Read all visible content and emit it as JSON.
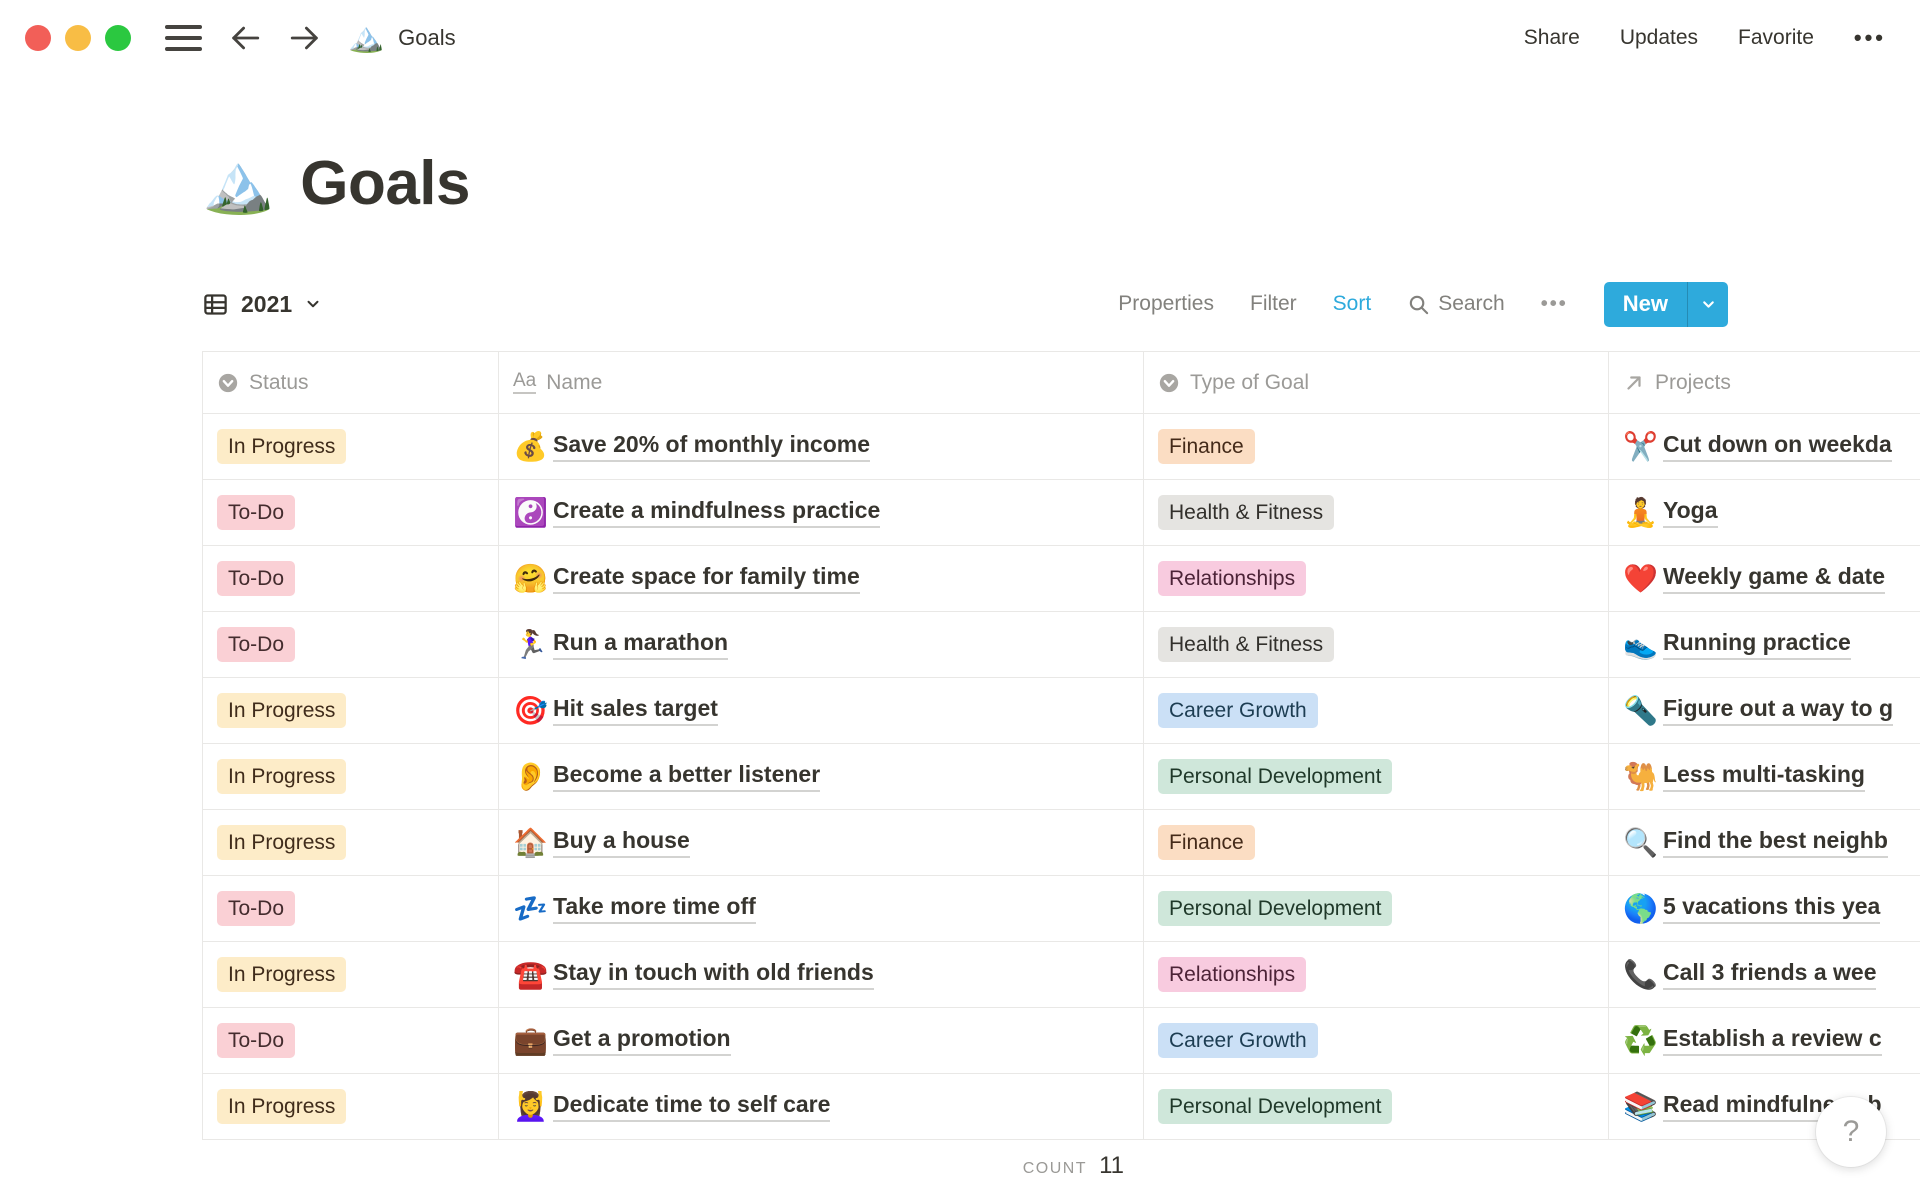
{
  "window": {
    "doc_emoji": "🏔️",
    "doc_title": "Goals",
    "actions": {
      "share": "Share",
      "updates": "Updates",
      "favorite": "Favorite"
    }
  },
  "page": {
    "emoji": "🏔️",
    "title": "Goals"
  },
  "viewbar": {
    "view_name": "2021",
    "properties": "Properties",
    "filter": "Filter",
    "sort": "Sort",
    "search": "Search",
    "new_label": "New"
  },
  "table": {
    "columns": [
      {
        "label": "Status"
      },
      {
        "label": "Name"
      },
      {
        "label": "Type of Goal"
      },
      {
        "label": "Projects"
      }
    ],
    "rows": [
      {
        "status": {
          "label": "In Progress",
          "variant": "in-progress"
        },
        "name": {
          "emoji": "💰",
          "text": "Save 20% of monthly income"
        },
        "type": {
          "label": "Finance",
          "variant": "finance"
        },
        "project": {
          "emoji": "✂️",
          "text": "Cut down on weekda"
        }
      },
      {
        "status": {
          "label": "To-Do",
          "variant": "to-do"
        },
        "name": {
          "emoji": "☯️",
          "text": "Create a mindfulness practice"
        },
        "type": {
          "label": "Health & Fitness",
          "variant": "health"
        },
        "project": {
          "emoji": "🧘",
          "text": "Yoga"
        }
      },
      {
        "status": {
          "label": "To-Do",
          "variant": "to-do"
        },
        "name": {
          "emoji": "🤗",
          "text": "Create space for family time"
        },
        "type": {
          "label": "Relationships",
          "variant": "relationships"
        },
        "project": {
          "emoji": "❤️",
          "text": "Weekly game & date"
        }
      },
      {
        "status": {
          "label": "To-Do",
          "variant": "to-do"
        },
        "name": {
          "emoji": "🏃‍♀️",
          "text": "Run a marathon"
        },
        "type": {
          "label": "Health & Fitness",
          "variant": "health"
        },
        "project": {
          "emoji": "👟",
          "text": "Running practice"
        }
      },
      {
        "status": {
          "label": "In Progress",
          "variant": "in-progress"
        },
        "name": {
          "emoji": "🎯",
          "text": "Hit sales target"
        },
        "type": {
          "label": "Career Growth",
          "variant": "career"
        },
        "project": {
          "emoji": "🔦",
          "text": "Figure out a way to g"
        }
      },
      {
        "status": {
          "label": "In Progress",
          "variant": "in-progress"
        },
        "name": {
          "emoji": "👂",
          "text": "Become a better listener"
        },
        "type": {
          "label": "Personal Development",
          "variant": "personal"
        },
        "project": {
          "emoji": "🐫",
          "text": "Less multi-tasking"
        }
      },
      {
        "status": {
          "label": "In Progress",
          "variant": "in-progress"
        },
        "name": {
          "emoji": "🏠",
          "text": "Buy a house"
        },
        "type": {
          "label": "Finance",
          "variant": "finance"
        },
        "project": {
          "emoji": "🔍",
          "text": "Find the best neighb"
        }
      },
      {
        "status": {
          "label": "To-Do",
          "variant": "to-do"
        },
        "name": {
          "emoji": "💤",
          "text": "Take more time off"
        },
        "type": {
          "label": "Personal Development",
          "variant": "personal"
        },
        "project": {
          "emoji": "🌎",
          "text": "5 vacations this yea"
        }
      },
      {
        "status": {
          "label": "In Progress",
          "variant": "in-progress"
        },
        "name": {
          "emoji": "☎️",
          "text": "Stay in touch with old friends"
        },
        "type": {
          "label": "Relationships",
          "variant": "relationships"
        },
        "project": {
          "emoji": "📞",
          "text": "Call 3 friends a wee"
        }
      },
      {
        "status": {
          "label": "To-Do",
          "variant": "to-do"
        },
        "name": {
          "emoji": "💼",
          "text": "Get a promotion"
        },
        "type": {
          "label": "Career Growth",
          "variant": "career"
        },
        "project": {
          "emoji": "♻️",
          "text": "Establish a review c"
        }
      },
      {
        "status": {
          "label": "In Progress",
          "variant": "in-progress"
        },
        "name": {
          "emoji": "💆‍♀️",
          "text": "Dedicate time to self care"
        },
        "type": {
          "label": "Personal Development",
          "variant": "personal"
        },
        "project": {
          "emoji": "📚",
          "text": "Read mindfulness b"
        }
      }
    ],
    "footer": {
      "count_label": "COUNT",
      "count_value": "11"
    }
  },
  "help": {
    "label": "?"
  },
  "colors": {
    "accent-blue": "#2EAADC",
    "border": "#E9E8E6",
    "status-inprogress-bg": "#FDECC8",
    "status-todo-bg": "#FAD0D5",
    "type-finance-bg": "#FBDDC3",
    "type-health-bg": "#E5E4E1",
    "type-relationships-bg": "#F8CBDF",
    "type-career-bg": "#CBE0F6",
    "type-personal-bg": "#CFE7DA"
  }
}
